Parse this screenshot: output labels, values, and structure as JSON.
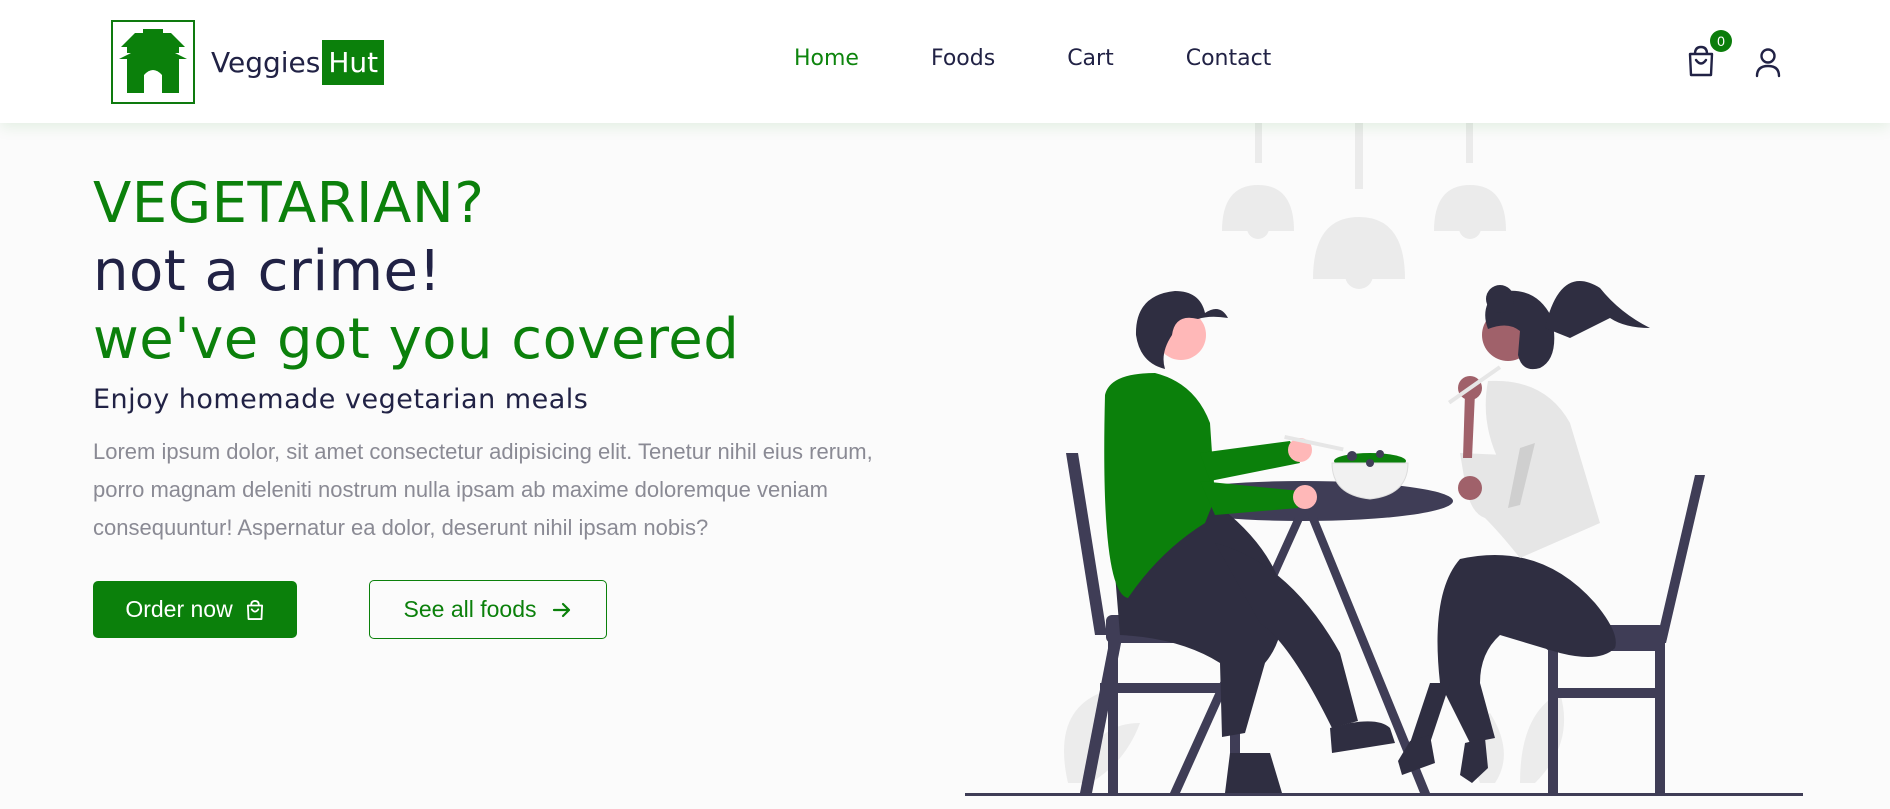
{
  "header": {
    "brand_name": "Veggies",
    "brand_highlight": "Hut",
    "nav": [
      {
        "label": "Home",
        "active": true
      },
      {
        "label": "Foods",
        "active": false
      },
      {
        "label": "Cart",
        "active": false
      },
      {
        "label": "Contact",
        "active": false
      }
    ],
    "cart_count": "0",
    "icons": {
      "logo": "pagoda-icon",
      "cart": "shopping-bag-icon",
      "user": "user-icon"
    }
  },
  "hero": {
    "line1": "VEGETARIAN?",
    "line2": "not a crime!",
    "line3": "we've got you covered",
    "subtitle": "Enjoy homemade vegetarian meals",
    "description": "Lorem ipsum dolor, sit amet consectetur adipisicing elit. Tenetur nihil eius rerum, porro magnam deleniti nostrum nulla ipsam ab maxime doloremque veniam consequuntur! Aspernatur ea dolor, deserunt nihil ipsam nobis?",
    "order_button": "Order now",
    "foods_button": "See all foods"
  },
  "colors": {
    "accent": "#0b800b",
    "text": "#212245",
    "muted": "#8a8a94",
    "background": "#fbfbfb"
  }
}
